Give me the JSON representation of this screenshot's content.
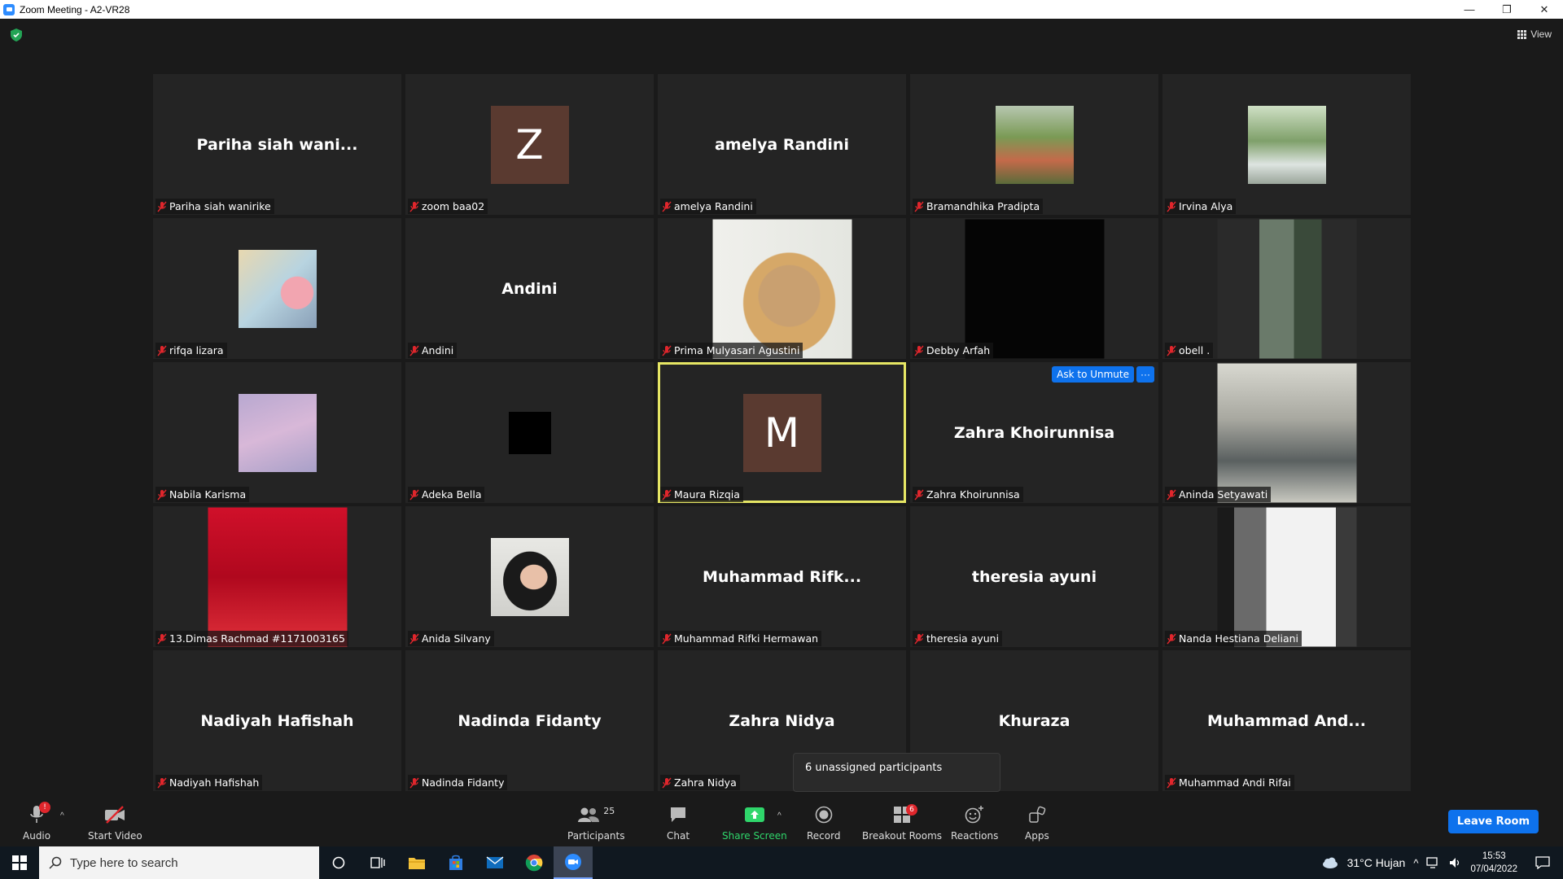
{
  "window": {
    "title": "Zoom Meeting - A2-VR28"
  },
  "view_label": "View",
  "tiles": [
    {
      "big": "Pariha siah wani...",
      "label": "Pariha siah wanirike",
      "kind": "name"
    },
    {
      "big": "Z",
      "label": "zoom baa02",
      "kind": "avatar"
    },
    {
      "big": "amelya Randini",
      "label": "amelya Randini",
      "kind": "name"
    },
    {
      "big": "",
      "label": "Bramandhika Pradipta",
      "kind": "photo-garden"
    },
    {
      "big": "",
      "label": "Irvina Alya",
      "kind": "photo-green"
    },
    {
      "big": "",
      "label": "rifqa lizara",
      "kind": "photo-balloon"
    },
    {
      "big": "Andini",
      "label": "Andini",
      "kind": "name"
    },
    {
      "big": "",
      "label": "Prima Mulyasari Agustini",
      "kind": "photo-hijab-large"
    },
    {
      "big": "",
      "label": "Debby Arfah",
      "kind": "photo-black-large"
    },
    {
      "big": "",
      "label": "obell .",
      "kind": "photo-cafe"
    },
    {
      "big": "",
      "label": "Nabila Karisma",
      "kind": "photo-rainbow"
    },
    {
      "big": "",
      "label": "Adeka Bella",
      "kind": "photo-black-small"
    },
    {
      "big": "M",
      "label": "Maura Rizqia",
      "kind": "avatar",
      "active": true
    },
    {
      "big": "Zahra Khoirunnisa",
      "label": "Zahra Khoirunnisa",
      "kind": "name"
    },
    {
      "big": "",
      "label": "Aninda Setyawati",
      "kind": "photo-stairs"
    },
    {
      "big": "",
      "label": "13.Dimas Rachmad #1171003165",
      "kind": "photo-red"
    },
    {
      "big": "",
      "label": "Anida Silvany",
      "kind": "photo-hijab-small"
    },
    {
      "big": "Muhammad  Rifk...",
      "label": "Muhammad Rifki Hermawan",
      "kind": "name"
    },
    {
      "big": "theresia ayuni",
      "label": "theresia ayuni",
      "kind": "name"
    },
    {
      "big": "",
      "label": "Nanda Hestiana Deliani",
      "kind": "photo-window"
    },
    {
      "big": "Nadiyah Hafishah",
      "label": "Nadiyah Hafishah",
      "kind": "name"
    },
    {
      "big": "Nadinda Fidanty",
      "label": "Nadinda Fidanty",
      "kind": "name"
    },
    {
      "big": "Zahra Nidya",
      "label": "Zahra Nidya",
      "kind": "name"
    },
    {
      "big": "Khuraza",
      "label": "Khuraza",
      "kind": "name"
    },
    {
      "big": "Muhammad  And...",
      "label": "Muhammad Andi Rifai",
      "kind": "name"
    }
  ],
  "ask_unmute": "Ask to Unmute",
  "more_dots": "···",
  "tooltip": "6 unassigned participants",
  "toolbar": {
    "audio": "Audio",
    "start_video": "Start Video",
    "participants": "Participants",
    "participants_count": "25",
    "chat": "Chat",
    "share_screen": "Share Screen",
    "record": "Record",
    "breakout_rooms": "Breakout Rooms",
    "breakout_badge": "6",
    "reactions": "Reactions",
    "apps": "Apps",
    "leave": "Leave Room",
    "audio_badge": "!"
  },
  "taskbar": {
    "search_placeholder": "Type here to search",
    "weather": "31°C  Hujan",
    "time": "15:53",
    "date": "07/04/2022"
  },
  "colors": {
    "accent": "#0e72ed",
    "active_border": "#e6e664",
    "share_green": "#2fd66b",
    "tile_bg": "#242424"
  }
}
